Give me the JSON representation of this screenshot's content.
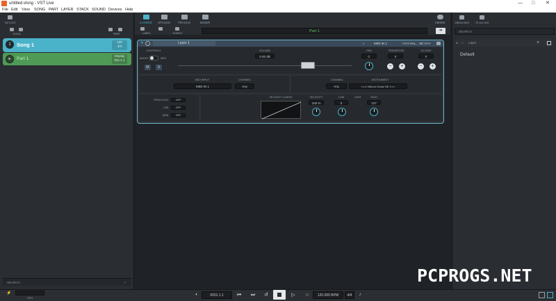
{
  "titlebar": {
    "title": "untitled.vlsng - VST Live",
    "min": "—",
    "max": "□",
    "close": "✕"
  },
  "menu": [
    "File",
    "Edit",
    "View",
    "SONG",
    "PART",
    "LAYER",
    "STACK",
    "SOUND",
    "Devices",
    "Help"
  ],
  "left": {
    "setlist_label": "SETLIST",
    "song_btn_label": "SONG",
    "part_btn_label": "PART",
    "song": {
      "name": "Song 1",
      "tempo": "120",
      "signature": "4/4"
    },
    "part": {
      "name": "Part 1",
      "badge_top": "Display",
      "badge_bottom": "001.1.1"
    },
    "search_placeholder": "SEARCH"
  },
  "tabs": [
    {
      "label": "LAYERS",
      "active": true
    },
    {
      "label": "STACKS",
      "active": false
    },
    {
      "label": "TRACKS",
      "active": false
    },
    {
      "label": "MIXER",
      "active": false
    }
  ],
  "views_label": "VIEWS",
  "sub": {
    "label_btn": "LABEL",
    "zones_btn": "ZONES",
    "part_name": "Part 1",
    "arrow": "➔"
  },
  "layer": {
    "name": "Layer 1",
    "midi_in": "MIDI IN 1",
    "instrument_short": "<<<! HAL... SE !>>>",
    "controls_label": "CONTROLS",
    "audio_label": "AUDIO",
    "midi_label": "MIDI",
    "m_btn": "M",
    "s_btn": "S",
    "volume_label": "VOLUME",
    "volume_value": "0.00 dB",
    "pan_label": "PAN",
    "pan_value": "C",
    "transpose_label": "TRANSPOSE",
    "transpose_value": "0",
    "octave_label": "OCTAVE",
    "octave_value": "0",
    "minus": "−",
    "plus": "+",
    "midi_input_label": "MIDI INPUT",
    "midi_input_value": "MIDI IN 1",
    "channel_label": "CHANNEL",
    "channel_value": "Any",
    "channel2_label": "CHANNEL",
    "channel2_value": "Any",
    "instrument_label": "INSTRUMENT",
    "instrument_value": "<<<! HALion Sonic SE !>>>",
    "prgm_chg_label": "PRGM CHG",
    "lsb_label": "LSB",
    "msb_label": "MSB",
    "off": "OFF",
    "velocity_curve_label": "VELOCITY CURVE",
    "velocity_label": "VELOCITY",
    "velocity_value": "100 %",
    "low_label": "LOW",
    "low_value": "0",
    "limit_label": "LIMIT",
    "high_label": "HIGH",
    "high_value": "127"
  },
  "right": {
    "media_bay_label": "MEDIA BAY",
    "plugins_label": "PLUG-INS",
    "search_placeholder": "SEARCH",
    "path": "Layer",
    "item": "Default"
  },
  "bottom": {
    "position": "0001.1.1",
    "tempo": "120.000 BPM",
    "signature": "4/4",
    "level_label": "CPU"
  },
  "watermark": "PCPROGS.NET",
  "colors": {
    "accent": "#4ab3c9",
    "part_green": "#4f9a55",
    "part_text": "#5fc267"
  }
}
